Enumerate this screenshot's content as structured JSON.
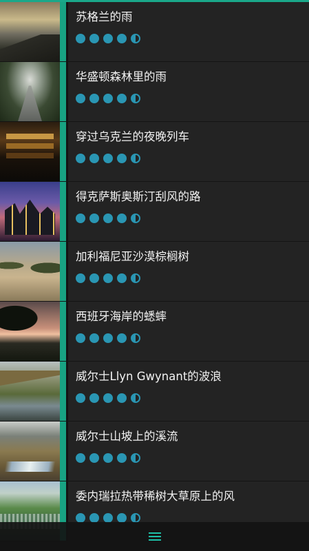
{
  "items": [
    {
      "title": "苏格兰的雨",
      "rating": 4.5
    },
    {
      "title": "华盛顿森林里的雨",
      "rating": 4.5
    },
    {
      "title": "穿过乌克兰的夜晚列车",
      "rating": 4.5
    },
    {
      "title": "得克萨斯奥斯汀刮风的路",
      "rating": 4.5
    },
    {
      "title": "加利福尼亚沙漠棕榈树",
      "rating": 4.5
    },
    {
      "title": "西班牙海岸的蟋蟀",
      "rating": 4.5
    },
    {
      "title": "威尔士Llyn Gwynant的波浪",
      "rating": 4.5
    },
    {
      "title": "威尔士山坡上的溪流",
      "rating": 4.5
    },
    {
      "title": "委内瑞拉热带稀树大草原上的风",
      "rating": 4.5
    }
  ],
  "colors": {
    "accent": "#18a383",
    "rating": "#2a96b3",
    "background": "#232323"
  },
  "bottom_bar": {
    "icon": "menu-icon"
  }
}
